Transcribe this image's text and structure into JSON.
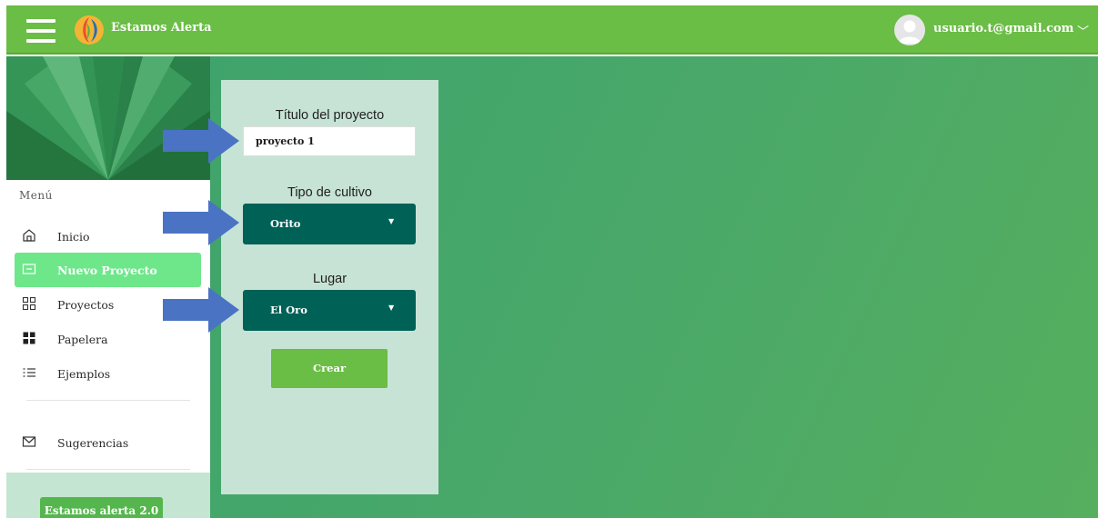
{
  "app": {
    "title": "Estamos Alerta",
    "user_email": "usuario.t@gmail.com"
  },
  "sidebar": {
    "menu_title": "Menú",
    "items": [
      {
        "label": "Inicio",
        "icon": "home-icon",
        "active": false
      },
      {
        "label": "Nuevo Proyecto",
        "icon": "new-project-icon",
        "active": true
      },
      {
        "label": "Proyectos",
        "icon": "grid-icon",
        "active": false
      },
      {
        "label": "Papelera",
        "icon": "trash-grid-icon",
        "active": false
      },
      {
        "label": "Ejemplos",
        "icon": "list-icon",
        "active": false
      }
    ],
    "suggestions_label": "Sugerencias",
    "footer_button": "Estamos alerta 2.0"
  },
  "form": {
    "title_label": "Título del proyecto",
    "title_value": "proyecto 1",
    "crop_label": "Tipo de cultivo",
    "crop_value": "Orito",
    "place_label": "Lugar",
    "place_value": "El Oro",
    "create_label": "Crear"
  },
  "colors": {
    "topbar": "#6abd45",
    "active_item": "#6ee78a",
    "select_bg": "#006157",
    "panel_bg": "#c7e3d6",
    "arrow": "#4a73c4"
  }
}
